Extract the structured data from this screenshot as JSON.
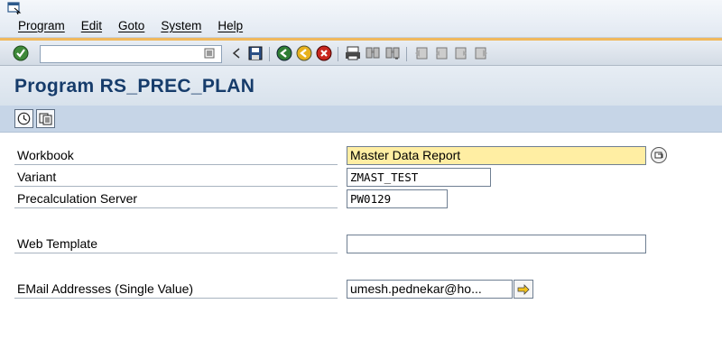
{
  "menu": {
    "items": [
      {
        "label": "Program"
      },
      {
        "label": "Edit"
      },
      {
        "label": "Goto"
      },
      {
        "label": "System"
      },
      {
        "label": "Help"
      }
    ]
  },
  "toolbar": {
    "command_field_value": "",
    "icons": [
      "enter-check-icon",
      "back-icon",
      "save-icon",
      "back-green-icon",
      "exit-yellow-icon",
      "cancel-red-icon",
      "print-icon",
      "find-icon",
      "find-next-icon",
      "first-page-icon",
      "previous-page-icon",
      "next-page-icon",
      "last-page-icon"
    ]
  },
  "title": "Program RS_PREC_PLAN",
  "app_toolbar": {
    "buttons": [
      "execute-icon",
      "get-variant-icon"
    ]
  },
  "form": {
    "workbook": {
      "label": "Workbook",
      "value": "Master Data Report"
    },
    "variant": {
      "label": "Variant",
      "value": "ZMAST_TEST"
    },
    "server": {
      "label": "Precalculation Server",
      "value": "PW0129"
    },
    "web_template": {
      "label": "Web Template",
      "value": ""
    },
    "email": {
      "label": "EMail Addresses (Single Value)",
      "value": "umesh.pednekar@ho..."
    }
  },
  "colors": {
    "title_text": "#163c6b",
    "toolbar_accent": "#f0b95e",
    "app_toolbar_bg": "#c6d5e7",
    "workbook_field_bg": "#ffeea3"
  }
}
